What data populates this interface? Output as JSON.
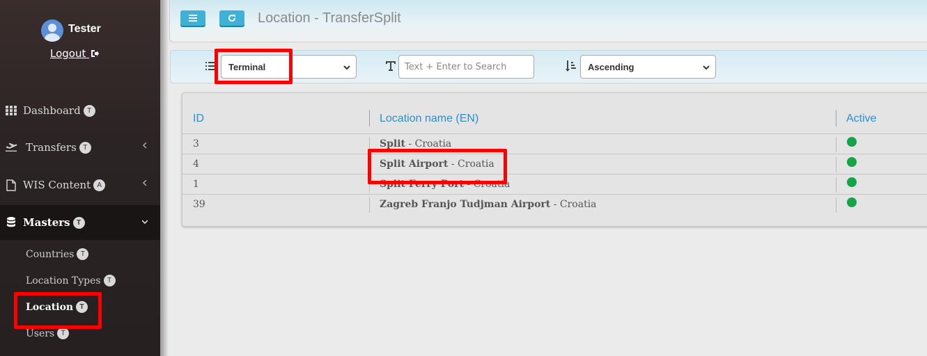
{
  "user": {
    "name": "Tester",
    "logout_label": "Logout"
  },
  "nav": [
    {
      "label": "Dashboard",
      "badge": "T",
      "icon": "grid-icon"
    },
    {
      "label": "Transfers",
      "badge": "T",
      "icon": "plane-icon"
    },
    {
      "label": "WIS Content",
      "badge": "A",
      "icon": "document-icon"
    },
    {
      "label": "Masters",
      "badge": "T",
      "icon": "database-icon"
    }
  ],
  "submenu": [
    {
      "label": "Countries",
      "badge": "T"
    },
    {
      "label": "Location Types",
      "badge": "T"
    },
    {
      "label": "Location",
      "badge": "T"
    },
    {
      "label": "Users",
      "badge": "T"
    }
  ],
  "header": {
    "title": "Location - TransferSplit"
  },
  "filters": {
    "field_value": "Terminal",
    "search_placeholder": "Text + Enter to Search",
    "sort_value": "Ascending"
  },
  "table": {
    "headers": [
      "ID",
      "Location name (EN)",
      "Active"
    ],
    "rows": [
      {
        "id": "3",
        "name": "Split",
        "country": " - Croatia",
        "active": true
      },
      {
        "id": "4",
        "name": "Split Airport",
        "country": " - Croatia",
        "active": true
      },
      {
        "id": "1",
        "name": "Split Ferry Port",
        "country": " - Croatia",
        "active": true
      },
      {
        "id": "39",
        "name": "Zagreb Franjo Tudjman Airport",
        "country": " - Croatia",
        "active": true
      }
    ]
  },
  "colors": {
    "accent": "#3eb1d8",
    "header_text": "#2a8fcc",
    "active_dot": "#14a548",
    "highlight": "#ff0000"
  }
}
